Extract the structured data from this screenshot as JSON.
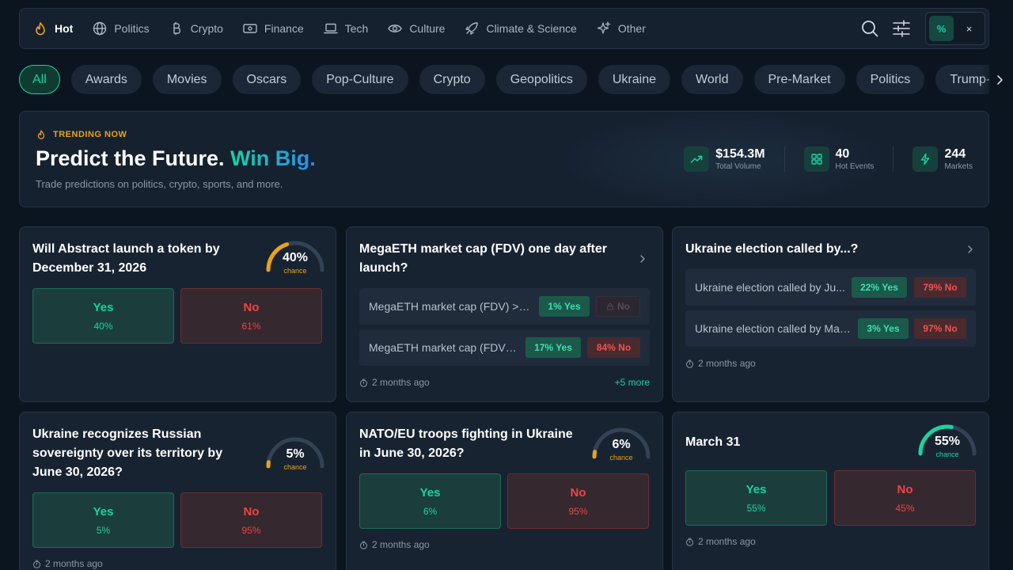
{
  "nav": {
    "items": [
      {
        "label": "Hot",
        "icon": "flame-icon",
        "active": true
      },
      {
        "label": "Politics",
        "icon": "globe-icon"
      },
      {
        "label": "Crypto",
        "icon": "bitcoin-icon"
      },
      {
        "label": "Finance",
        "icon": "banknote-icon"
      },
      {
        "label": "Tech",
        "icon": "laptop-icon"
      },
      {
        "label": "Culture",
        "icon": "eye-icon"
      },
      {
        "label": "Climate & Science",
        "icon": "rocket-icon"
      },
      {
        "label": "Other",
        "icon": "sparkle-icon"
      }
    ],
    "toggle_percent": "%",
    "toggle_close": "×"
  },
  "tags": [
    "All",
    "Awards",
    "Movies",
    "Oscars",
    "Pop-Culture",
    "Crypto",
    "Geopolitics",
    "Ukraine",
    "World",
    "Pre-Market",
    "Politics",
    "Trump-Zelenskyy"
  ],
  "hero": {
    "tag": "TRENDING NOW",
    "title_main": "Predict the Future.",
    "title_accent": "Win Big.",
    "subtitle": "Trade predictions on politics, crypto, sports, and more.",
    "stats": [
      {
        "value": "$154.3M",
        "label": "Total Volume",
        "icon": "trending-up-icon"
      },
      {
        "value": "40",
        "label": "Hot Events",
        "icon": "grid-icon"
      },
      {
        "value": "244",
        "label": "Markets",
        "icon": "bolt-icon"
      }
    ]
  },
  "colors": {
    "accent": "#19d3a2",
    "danger": "#ef4444",
    "warning": "#e8a317",
    "background": "#0b1520",
    "card": "#182332"
  },
  "cards": {
    "abstract": {
      "title": "Will Abstract launch a token by December 31, 2026",
      "chance": "40%",
      "chance_label": "chance",
      "chance_value": 40,
      "yes_label": "Yes",
      "yes_pct": "40%",
      "no_label": "No",
      "no_pct": "61%"
    },
    "megaeth": {
      "title": "MegaETH market cap (FDV) one day after launch?",
      "rows": [
        {
          "name": "MegaETH market cap (FDV) >$...",
          "yes": "1% Yes",
          "no": "No"
        },
        {
          "name": "MegaETH market cap (FDV) ...",
          "yes": "17% Yes",
          "no": "84% No"
        }
      ],
      "time": "2 months ago",
      "more": "+5 more"
    },
    "ukraine_election": {
      "title": "Ukraine election called by...?",
      "rows": [
        {
          "name": "Ukraine election called by Ju...",
          "yes": "22% Yes",
          "no": "79% No"
        },
        {
          "name": "Ukraine election called by Mar...",
          "yes": "3% Yes",
          "no": "97% No"
        }
      ],
      "time": "2 months ago"
    },
    "sovereignty": {
      "title": "Ukraine recognizes Russian sovereignty over its territory by June 30, 2026?",
      "chance": "5%",
      "chance_label": "chance",
      "chance_value": 5,
      "yes_label": "Yes",
      "yes_pct": "5%",
      "no_label": "No",
      "no_pct": "95%",
      "time": "2 months ago"
    },
    "nato": {
      "title": "NATO/EU troops fighting in Ukraine in June 30, 2026?",
      "chance": "6%",
      "chance_label": "chance",
      "chance_value": 6,
      "yes_label": "Yes",
      "yes_pct": "6%",
      "no_label": "No",
      "no_pct": "95%",
      "time": "2 months ago"
    },
    "march": {
      "title": "March 31",
      "chance": "55%",
      "chance_label": "chance",
      "chance_value": 55,
      "yes_label": "Yes",
      "yes_pct": "55%",
      "no_label": "No",
      "no_pct": "45%",
      "time": "2 months ago"
    }
  }
}
